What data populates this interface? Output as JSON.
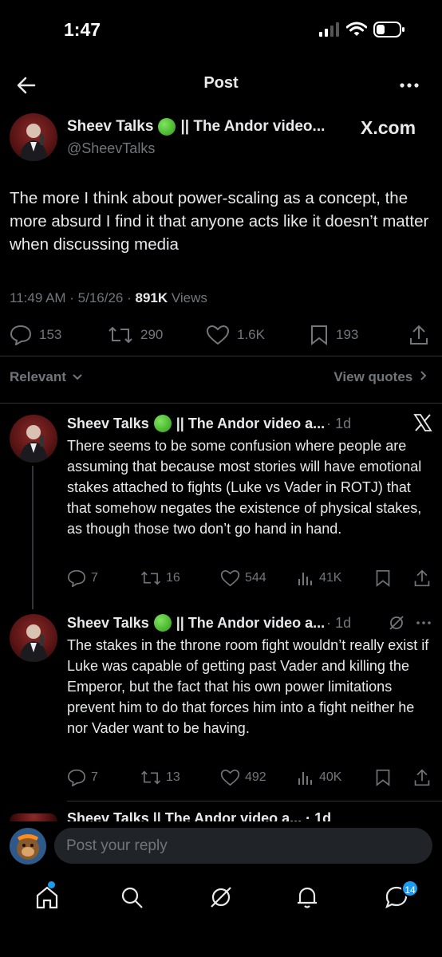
{
  "status_bar": {
    "time": "1:47"
  },
  "nav": {
    "title": "Post"
  },
  "post": {
    "author_name": "Sheev Talks",
    "author_suffix": "|| The Andor video...",
    "handle": "@SheevTalks",
    "source_label": "X.com",
    "text": "The more I think about power-scaling as a concept, the more absurd I find it that anyone acts like it doesn’t matter when discussing media",
    "meta_time": "11:49 AM · 5/16/26 · ",
    "views_count": "891K",
    "views_label": " Views",
    "stats": {
      "replies": "153",
      "reposts": "290",
      "likes": "1.6K",
      "bookmarks": "193"
    }
  },
  "filter": {
    "relevant_label": "Relevant",
    "view_quotes_label": "View quotes"
  },
  "replies": [
    {
      "author_name": "Sheev Talks",
      "author_suffix": "|| The Andor video a...",
      "time": "· 1d",
      "text": "There seems to be some confusion where people are assuming that because most stories will have emotional stakes attached to fights (Luke vs Vader in ROTJ) that that somehow negates the existence of physical stakes, as though those two don’t go hand in hand.",
      "stats": {
        "replies": "7",
        "reposts": "16",
        "likes": "544",
        "views": "41K"
      }
    },
    {
      "author_name": "Sheev Talks",
      "author_suffix": "|| The Andor video a...",
      "time": "· 1d",
      "text": "The stakes in the throne room fight wouldn’t really exist if Luke was capable of getting past Vader and killing the Emperor, but the fact that his own power limitations prevent him to do that forces him into a fight neither he nor Vader want to be having.",
      "stats": {
        "replies": "7",
        "reposts": "13",
        "likes": "492",
        "views": "40K"
      }
    }
  ],
  "partial_reply": {
    "text": "Sheev Talks || The Andor video a... · 1d"
  },
  "composer": {
    "placeholder": "Post your reply"
  },
  "tabbar": {
    "messages_badge": "14"
  },
  "colors": {
    "accent": "#1d9bf0",
    "background": "#000000",
    "muted": "#71767b"
  }
}
